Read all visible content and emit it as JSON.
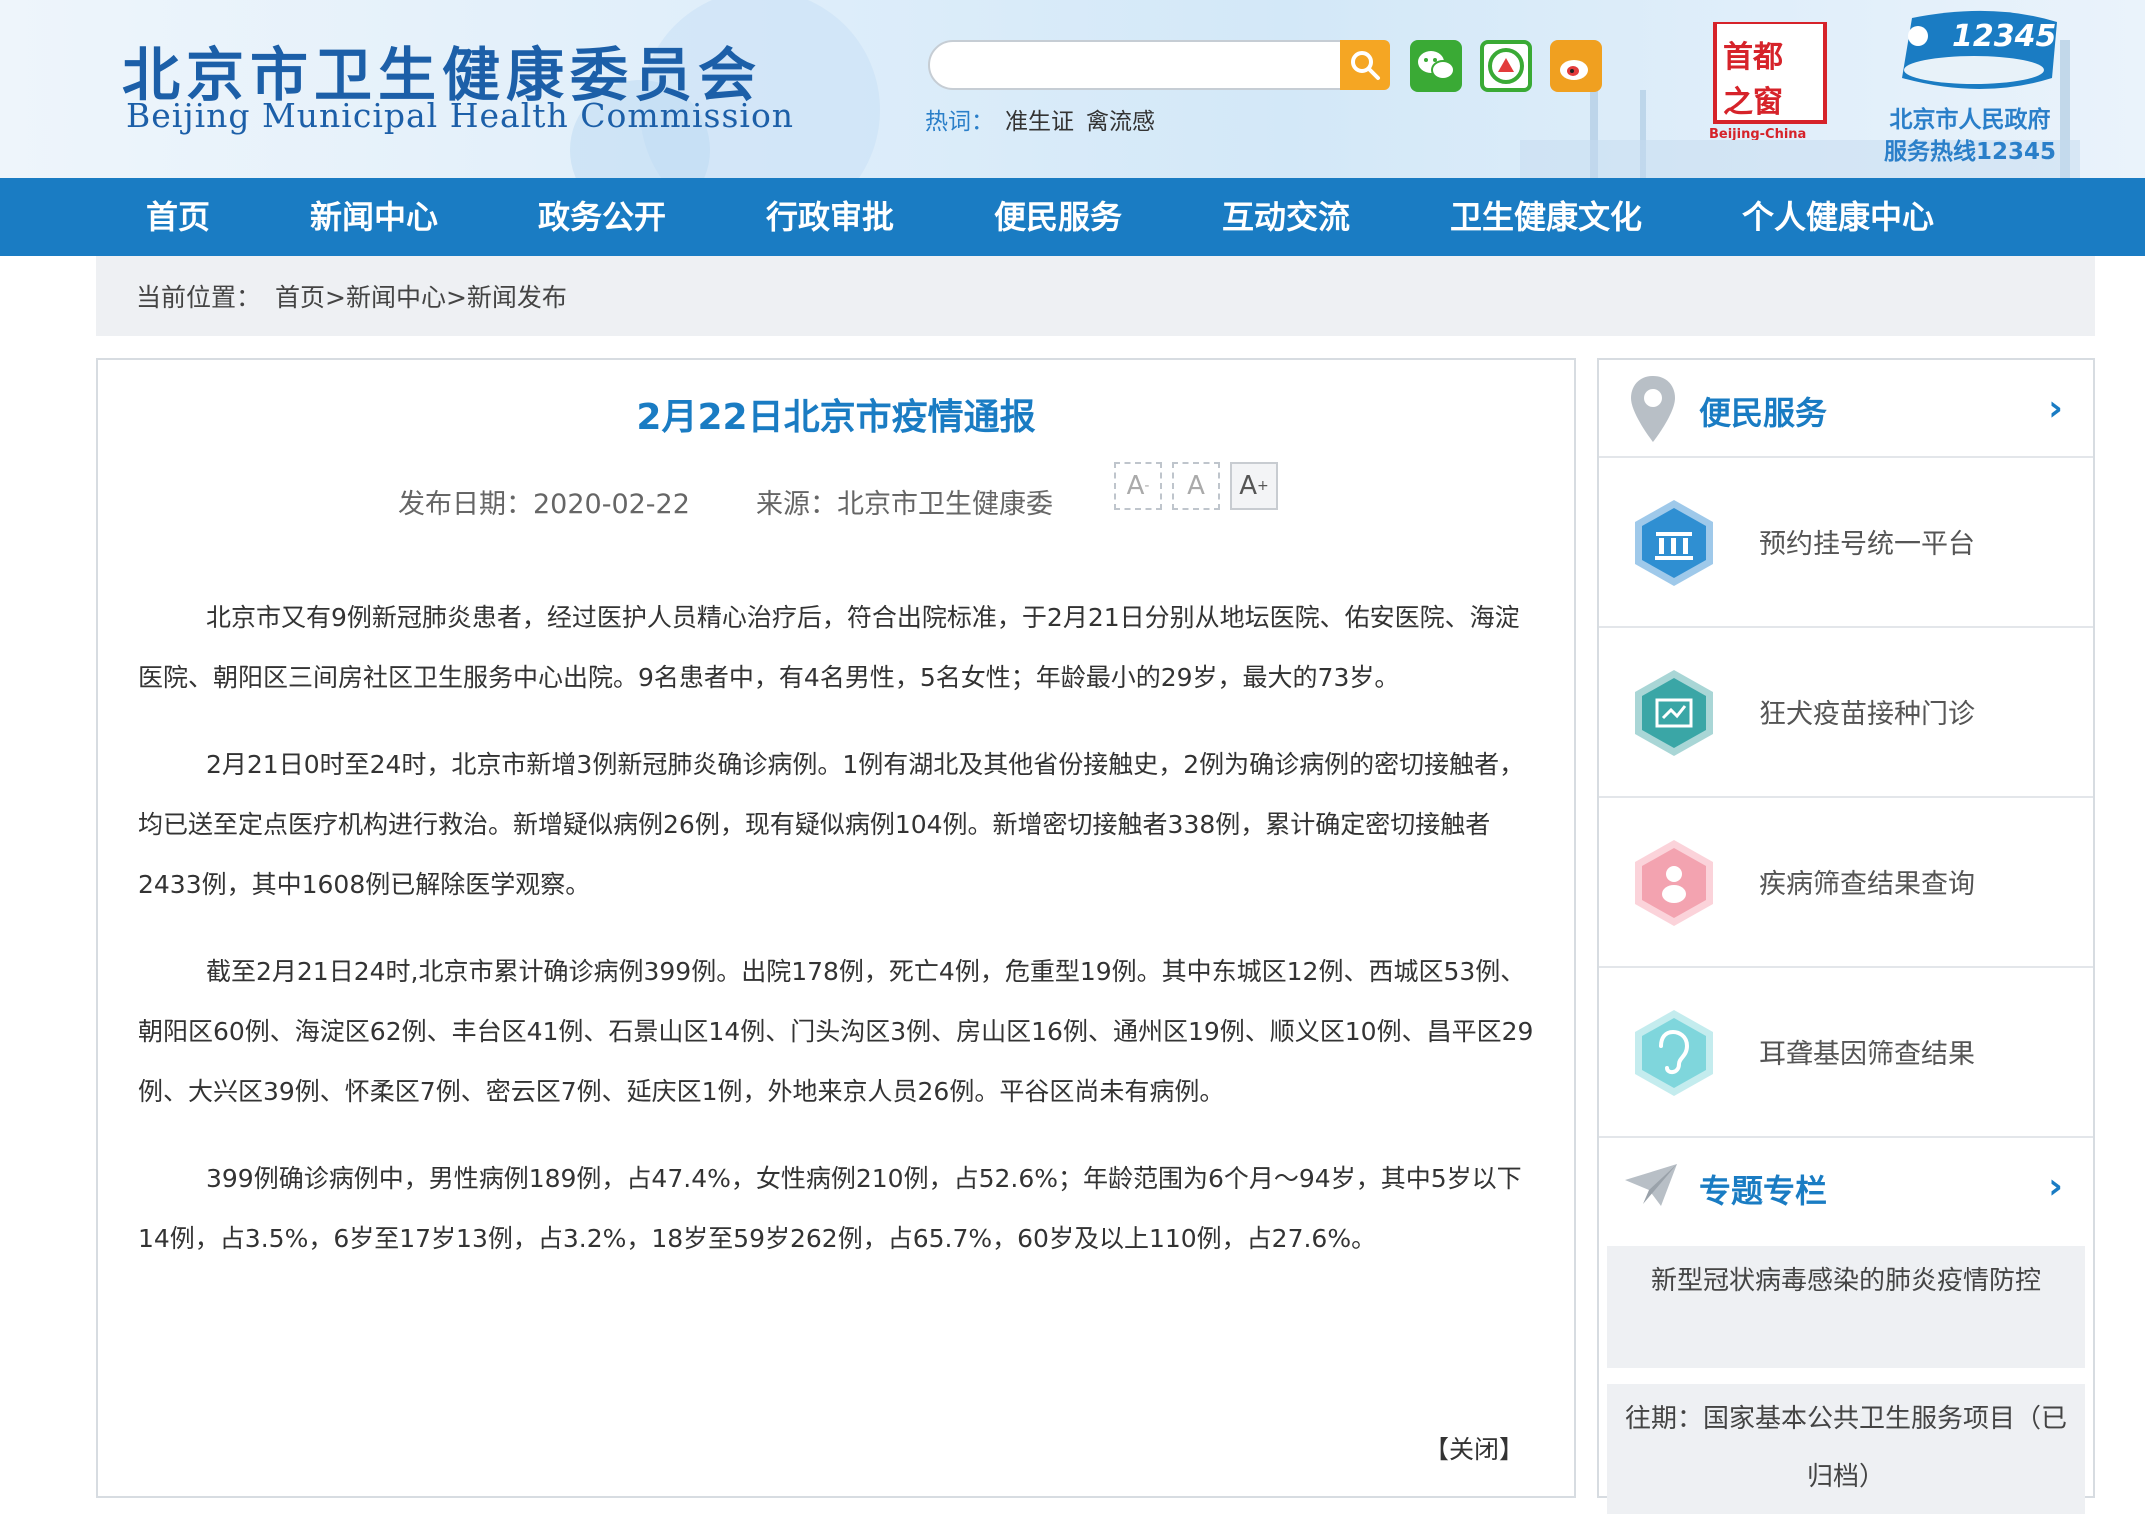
{
  "header": {
    "logo_cn": "北京市卫生健康委员会",
    "logo_en": "Beijing Municipal Health Commission",
    "search_placeholder": "",
    "hot_label": "热词：",
    "hot_words": [
      "准生证",
      "禽流感"
    ],
    "shoudu_line1": "首都",
    "shoudu_line2": "之窗",
    "shoudu_en": "Beijing-China",
    "hotline_number": "12345",
    "hotline_line1": "北京市人民政府",
    "hotline_line2": "服务热线12345"
  },
  "nav": [
    "首页",
    "新闻中心",
    "政务公开",
    "行政审批",
    "便民服务",
    "互动交流",
    "卫生健康文化",
    "个人健康中心"
  ],
  "breadcrumb": {
    "label": "当前位置：",
    "path": "首页>新闻中心>新闻发布"
  },
  "article": {
    "title": "2月22日北京市疫情通报",
    "date_text": "发布日期：2020-02-22",
    "source_text": "来源：北京市卫生健康委",
    "font_small": "A",
    "font_normal": "A",
    "font_large": "A",
    "paragraphs": [
      "北京市又有9例新冠肺炎患者，经过医护人员精心治疗后，符合出院标准，于2月21日分别从地坛医院、佑安医院、海淀医院、朝阳区三间房社区卫生服务中心出院。9名患者中，有4名男性，5名女性；年龄最小的29岁，最大的73岁。",
      "2月21日0时至24时，北京市新增3例新冠肺炎确诊病例。1例有湖北及其他省份接触史，2例为确诊病例的密切接触者，均已送至定点医疗机构进行救治。新增疑似病例26例，现有疑似病例104例。新增密切接触者338例，累计确定密切接触者2433例，其中1608例已解除医学观察。",
      "截至2月21日24时,北京市累计确诊病例399例。出院178例，死亡4例，危重型19例。其中东城区12例、西城区53例、朝阳区60例、海淀区62例、丰台区41例、石景山区14例、门头沟区3例、房山区16例、通州区19例、顺义区10例、昌平区29例、大兴区39例、怀柔区7例、密云区7例、延庆区1例，外地来京人员26例。平谷区尚未有病例。",
      "399例确诊病例中，男性病例189例，占47.4%，女性病例210例，占52.6%；年龄范围为6个月～94岁，其中5岁以下14例，占3.5%，6岁至17岁13例，占3.2%，18岁至59岁262例，占65.7%，60岁及以上110例，占27.6%。"
    ],
    "close_label": "【关闭】"
  },
  "sidebar": {
    "service_title": "便民服务",
    "services": [
      "预约挂号统一平台",
      "狂犬疫苗接种门诊",
      "疾病筛查结果查询",
      "耳聋基因筛查结果"
    ],
    "topic_title": "专题专栏",
    "topics": [
      "新型冠状病毒感染的肺炎疫情防控",
      "往期：国家基本公共卫生服务项目（已归档）"
    ]
  },
  "colors": {
    "nav_blue": "#1a7cc3",
    "title_blue": "#1a7cc3",
    "search_orange": "#f5a623",
    "wechat_green": "#3aaa35",
    "weibo_orange": "#f0a020",
    "icon_blue": "#2f8fd2",
    "icon_teal": "#3aa6a6",
    "icon_pink": "#f3a3b0",
    "icon_cyan": "#7fd6dc"
  }
}
